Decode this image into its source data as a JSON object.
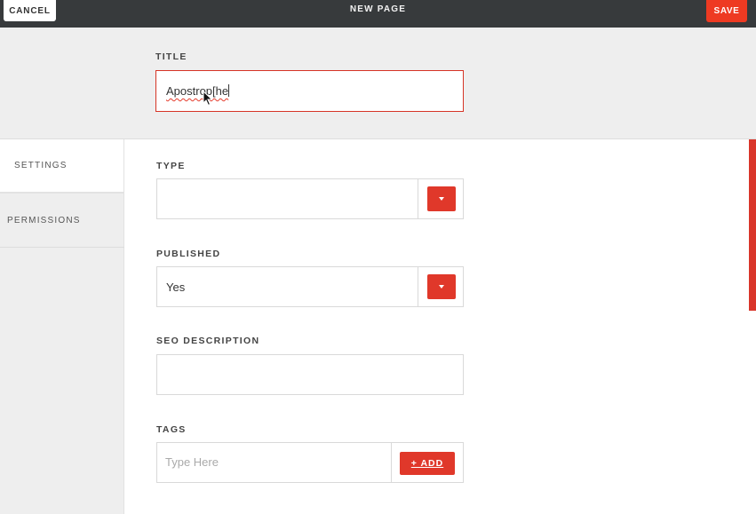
{
  "topbar": {
    "cancel_label": "CANCEL",
    "title": "NEW PAGE",
    "save_label": "SAVE"
  },
  "title_field": {
    "label": "TITLE",
    "value": "Apostrop[he"
  },
  "sidebar": {
    "tabs": [
      {
        "label": "SETTINGS",
        "active": true
      },
      {
        "label": "PERMISSIONS",
        "active": false
      }
    ]
  },
  "form": {
    "type": {
      "label": "TYPE",
      "value": ""
    },
    "published": {
      "label": "PUBLISHED",
      "value": "Yes"
    },
    "seo": {
      "label": "SEO DESCRIPTION",
      "value": ""
    },
    "tags": {
      "label": "TAGS",
      "placeholder": "Type Here",
      "add_label": "+ ADD"
    }
  },
  "colors": {
    "accent": "#e0382a",
    "topbar": "#373a3c",
    "panel": "#eeeeee"
  },
  "icons": [
    "chevron-down-icon",
    "mouse-pointer-icon"
  ]
}
